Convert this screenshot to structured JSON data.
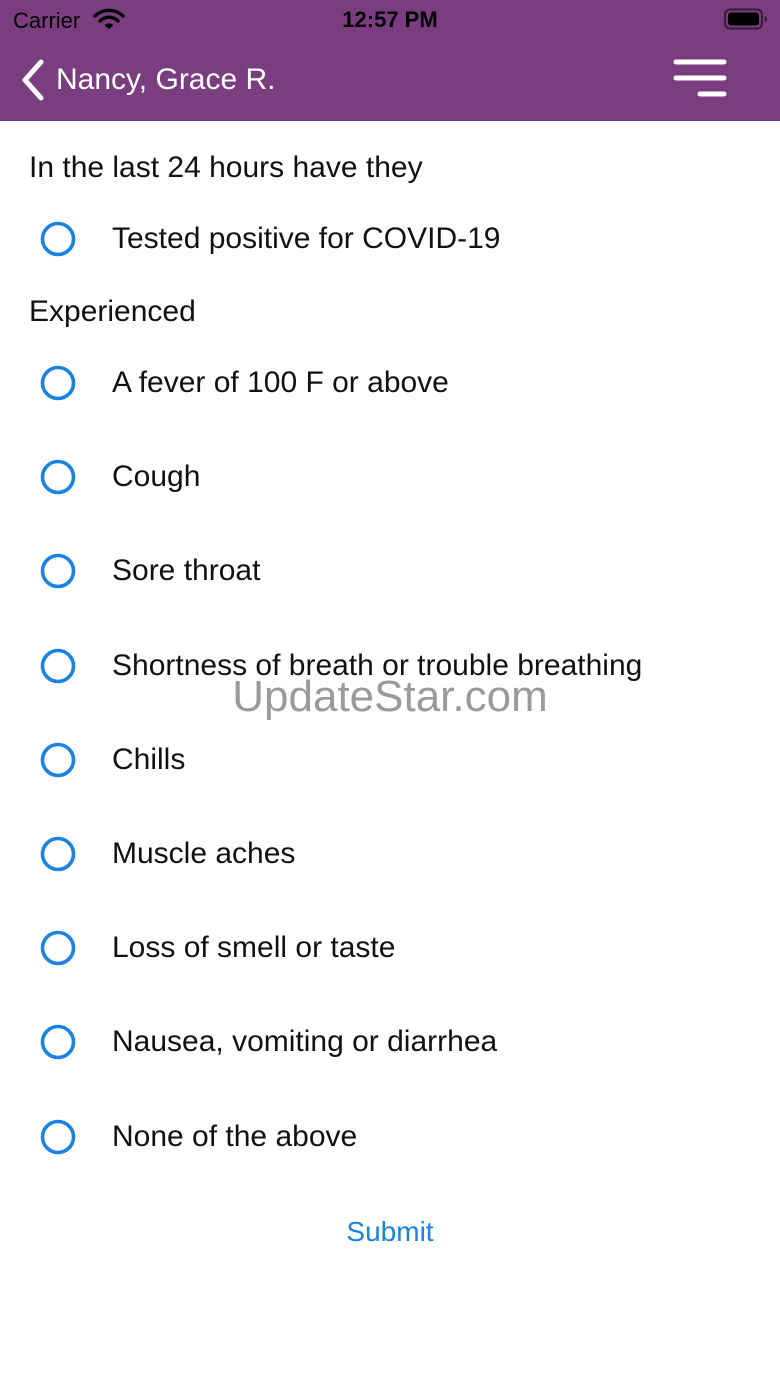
{
  "colors": {
    "header_bg": "#7a3e80",
    "radio_stroke": "#1a82e2",
    "link": "#1a82e2"
  },
  "status_bar": {
    "carrier": "Carrier",
    "time": "12:57 PM",
    "icons": [
      "wifi-icon",
      "battery-icon"
    ]
  },
  "nav": {
    "back_icon": "chevron-left-icon",
    "title": "Nancy, Grace R.",
    "menu_icon": "menu-icon"
  },
  "form": {
    "section1": {
      "title": "In the last 24 hours have they",
      "options": [
        {
          "label": "Tested positive for COVID-19",
          "checked": false
        }
      ]
    },
    "section2": {
      "title": "Experienced",
      "options": [
        {
          "label": "A fever of 100 F or above",
          "checked": false
        },
        {
          "label": "Cough",
          "checked": false
        },
        {
          "label": "Sore throat",
          "checked": false
        },
        {
          "label": "Shortness of breath or trouble breathing",
          "checked": false
        },
        {
          "label": "Chills",
          "checked": false
        },
        {
          "label": "Muscle aches",
          "checked": false
        },
        {
          "label": "Loss of smell or taste",
          "checked": false
        },
        {
          "label": "Nausea, vomiting or diarrhea",
          "checked": false
        },
        {
          "label": "None of the above",
          "checked": false
        }
      ]
    },
    "submit_label": "Submit"
  },
  "watermark": "UpdateStar.com"
}
